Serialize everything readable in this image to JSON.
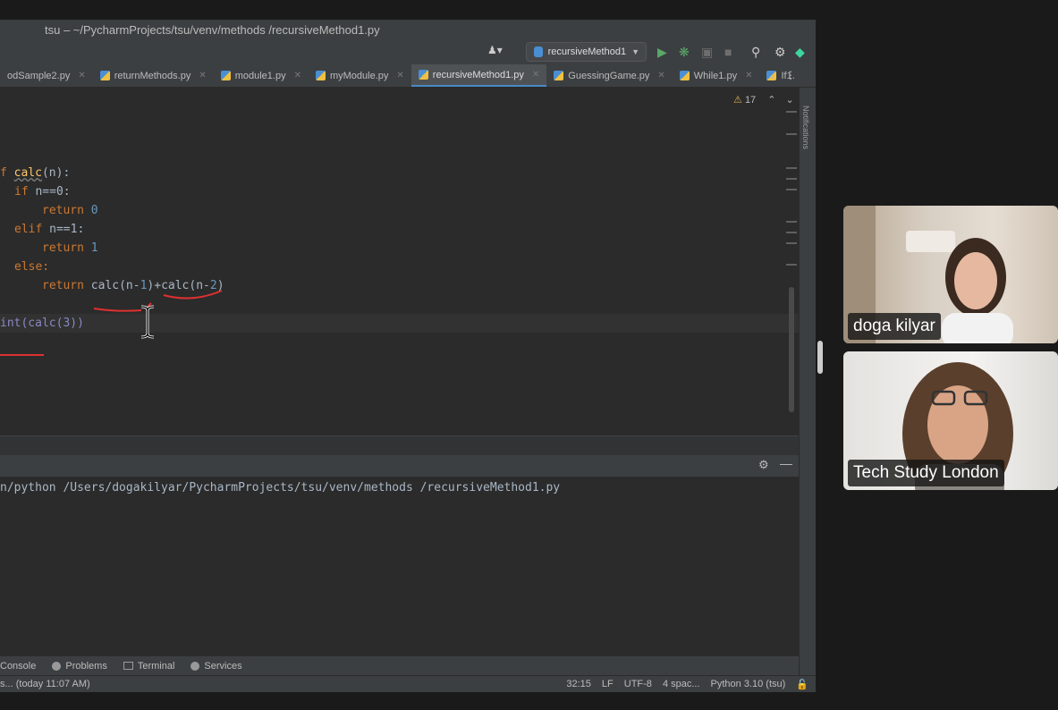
{
  "window": {
    "title": "tsu – ~/PycharmProjects/tsu/venv/methods /recursiveMethod1.py"
  },
  "toolbar": {
    "user_icon": "user-icon",
    "run_config_label": "recursiveMethod1"
  },
  "tabs": [
    {
      "label": "odSample2.py"
    },
    {
      "label": "returnMethods.py"
    },
    {
      "label": "module1.py"
    },
    {
      "label": "myModule.py"
    },
    {
      "label": "recursiveMethod1.py",
      "active": true
    },
    {
      "label": "GuessingGame.py"
    },
    {
      "label": "While1.py"
    },
    {
      "label": "If1."
    }
  ],
  "editor": {
    "warnings_count": "17",
    "code": {
      "l1_kw": "f ",
      "l1_fn": "calc",
      "l1_rest": "(n):",
      "l2_kw": "if ",
      "l2_rest": "n==0:",
      "l3_kw": "return ",
      "l3_num": "0",
      "l4_kw": "elif ",
      "l4_rest": "n==1:",
      "l5_kw": "return ",
      "l5_num": "1",
      "l6_kw": "else:",
      "l7_kw": "return ",
      "l7_a": "calc(n-",
      "l7_n1": "1",
      "l7_b": ")+calc(n-",
      "l7_n2": "2",
      "l7_c": ")",
      "l8": "int(calc(3))"
    }
  },
  "notifications_label": "Notifications",
  "console": {
    "command": "n/python /Users/dogakilyar/PycharmProjects/tsu/venv/methods /recursiveMethod1.py"
  },
  "bottom_tools": [
    {
      "label": "Console"
    },
    {
      "label": "Problems"
    },
    {
      "label": "Terminal"
    },
    {
      "label": "Services"
    }
  ],
  "statusbar": {
    "left": "s... (today 11:07 AM)",
    "position": "32:15",
    "line_sep": "LF",
    "encoding": "UTF-8",
    "indent": "4 spac...",
    "interpreter": "Python 3.10 (tsu)"
  },
  "participants": [
    {
      "name": "doga kilyar"
    },
    {
      "name": "Tech Study London"
    }
  ],
  "colors": {
    "accent": "#4a88c7",
    "annotation_red": "#e03030",
    "keyword": "#cc7832",
    "number": "#6897bb",
    "function": "#ffc66d"
  }
}
